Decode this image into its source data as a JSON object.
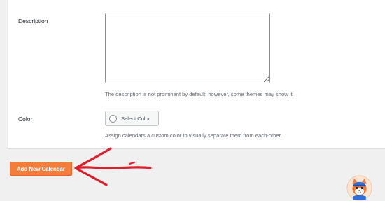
{
  "form": {
    "description": {
      "label": "Description",
      "value": "",
      "help": "The description is not prominent by default; however, some themes may show it."
    },
    "color": {
      "label": "Color",
      "button_label": "Select Color",
      "help": "Assign calendars a custom color to visually separate them from each-other."
    }
  },
  "actions": {
    "submit_label": "Add New Calendar"
  },
  "annotations": {
    "arrow_color": "#e11d2a",
    "button_color": "#f47d3a"
  },
  "icons": {
    "color_swatch": "color-swatch-icon",
    "mascot": "mascot-icon",
    "pointer_arrow": "arrow-annotation-icon"
  }
}
